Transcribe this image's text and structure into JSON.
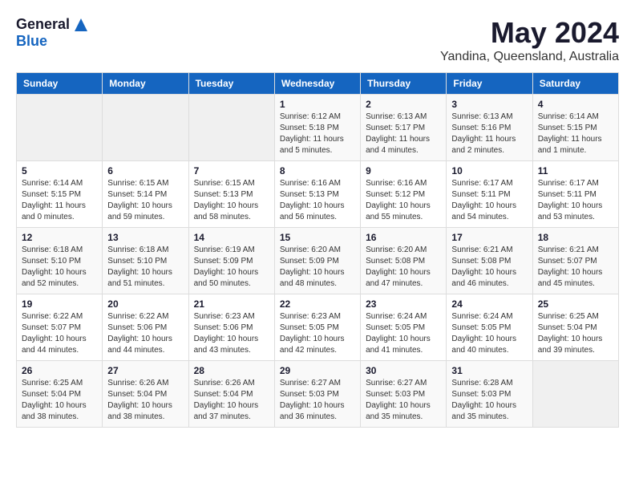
{
  "logo": {
    "general": "General",
    "blue": "Blue"
  },
  "title": {
    "month_year": "May 2024",
    "location": "Yandina, Queensland, Australia"
  },
  "days_of_week": [
    "Sunday",
    "Monday",
    "Tuesday",
    "Wednesday",
    "Thursday",
    "Friday",
    "Saturday"
  ],
  "weeks": [
    [
      {
        "day": "",
        "info": ""
      },
      {
        "day": "",
        "info": ""
      },
      {
        "day": "",
        "info": ""
      },
      {
        "day": "1",
        "info": "Sunrise: 6:12 AM\nSunset: 5:18 PM\nDaylight: 11 hours\nand 5 minutes."
      },
      {
        "day": "2",
        "info": "Sunrise: 6:13 AM\nSunset: 5:17 PM\nDaylight: 11 hours\nand 4 minutes."
      },
      {
        "day": "3",
        "info": "Sunrise: 6:13 AM\nSunset: 5:16 PM\nDaylight: 11 hours\nand 2 minutes."
      },
      {
        "day": "4",
        "info": "Sunrise: 6:14 AM\nSunset: 5:15 PM\nDaylight: 11 hours\nand 1 minute."
      }
    ],
    [
      {
        "day": "5",
        "info": "Sunrise: 6:14 AM\nSunset: 5:15 PM\nDaylight: 11 hours\nand 0 minutes."
      },
      {
        "day": "6",
        "info": "Sunrise: 6:15 AM\nSunset: 5:14 PM\nDaylight: 10 hours\nand 59 minutes."
      },
      {
        "day": "7",
        "info": "Sunrise: 6:15 AM\nSunset: 5:13 PM\nDaylight: 10 hours\nand 58 minutes."
      },
      {
        "day": "8",
        "info": "Sunrise: 6:16 AM\nSunset: 5:13 PM\nDaylight: 10 hours\nand 56 minutes."
      },
      {
        "day": "9",
        "info": "Sunrise: 6:16 AM\nSunset: 5:12 PM\nDaylight: 10 hours\nand 55 minutes."
      },
      {
        "day": "10",
        "info": "Sunrise: 6:17 AM\nSunset: 5:11 PM\nDaylight: 10 hours\nand 54 minutes."
      },
      {
        "day": "11",
        "info": "Sunrise: 6:17 AM\nSunset: 5:11 PM\nDaylight: 10 hours\nand 53 minutes."
      }
    ],
    [
      {
        "day": "12",
        "info": "Sunrise: 6:18 AM\nSunset: 5:10 PM\nDaylight: 10 hours\nand 52 minutes."
      },
      {
        "day": "13",
        "info": "Sunrise: 6:18 AM\nSunset: 5:10 PM\nDaylight: 10 hours\nand 51 minutes."
      },
      {
        "day": "14",
        "info": "Sunrise: 6:19 AM\nSunset: 5:09 PM\nDaylight: 10 hours\nand 50 minutes."
      },
      {
        "day": "15",
        "info": "Sunrise: 6:20 AM\nSunset: 5:09 PM\nDaylight: 10 hours\nand 48 minutes."
      },
      {
        "day": "16",
        "info": "Sunrise: 6:20 AM\nSunset: 5:08 PM\nDaylight: 10 hours\nand 47 minutes."
      },
      {
        "day": "17",
        "info": "Sunrise: 6:21 AM\nSunset: 5:08 PM\nDaylight: 10 hours\nand 46 minutes."
      },
      {
        "day": "18",
        "info": "Sunrise: 6:21 AM\nSunset: 5:07 PM\nDaylight: 10 hours\nand 45 minutes."
      }
    ],
    [
      {
        "day": "19",
        "info": "Sunrise: 6:22 AM\nSunset: 5:07 PM\nDaylight: 10 hours\nand 44 minutes."
      },
      {
        "day": "20",
        "info": "Sunrise: 6:22 AM\nSunset: 5:06 PM\nDaylight: 10 hours\nand 44 minutes."
      },
      {
        "day": "21",
        "info": "Sunrise: 6:23 AM\nSunset: 5:06 PM\nDaylight: 10 hours\nand 43 minutes."
      },
      {
        "day": "22",
        "info": "Sunrise: 6:23 AM\nSunset: 5:05 PM\nDaylight: 10 hours\nand 42 minutes."
      },
      {
        "day": "23",
        "info": "Sunrise: 6:24 AM\nSunset: 5:05 PM\nDaylight: 10 hours\nand 41 minutes."
      },
      {
        "day": "24",
        "info": "Sunrise: 6:24 AM\nSunset: 5:05 PM\nDaylight: 10 hours\nand 40 minutes."
      },
      {
        "day": "25",
        "info": "Sunrise: 6:25 AM\nSunset: 5:04 PM\nDaylight: 10 hours\nand 39 minutes."
      }
    ],
    [
      {
        "day": "26",
        "info": "Sunrise: 6:25 AM\nSunset: 5:04 PM\nDaylight: 10 hours\nand 38 minutes."
      },
      {
        "day": "27",
        "info": "Sunrise: 6:26 AM\nSunset: 5:04 PM\nDaylight: 10 hours\nand 38 minutes."
      },
      {
        "day": "28",
        "info": "Sunrise: 6:26 AM\nSunset: 5:04 PM\nDaylight: 10 hours\nand 37 minutes."
      },
      {
        "day": "29",
        "info": "Sunrise: 6:27 AM\nSunset: 5:03 PM\nDaylight: 10 hours\nand 36 minutes."
      },
      {
        "day": "30",
        "info": "Sunrise: 6:27 AM\nSunset: 5:03 PM\nDaylight: 10 hours\nand 35 minutes."
      },
      {
        "day": "31",
        "info": "Sunrise: 6:28 AM\nSunset: 5:03 PM\nDaylight: 10 hours\nand 35 minutes."
      },
      {
        "day": "",
        "info": ""
      }
    ]
  ]
}
